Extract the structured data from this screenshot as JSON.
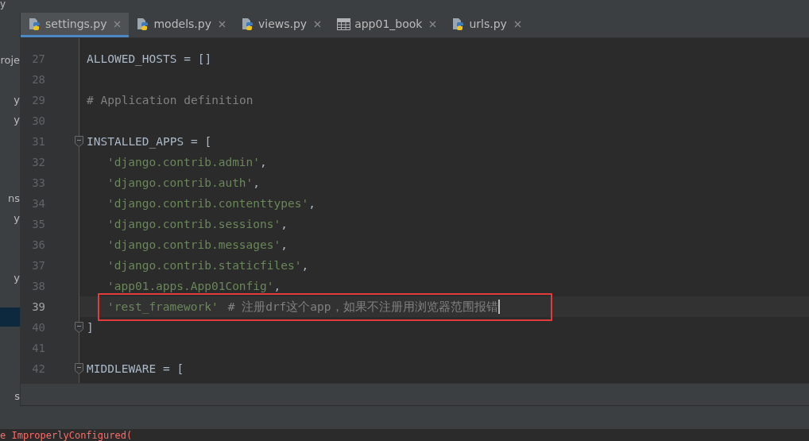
{
  "title_bar": {
    "text": "y"
  },
  "tabs": [
    {
      "label": "settings.py",
      "kind": "python",
      "selected": true
    },
    {
      "label": "models.py",
      "kind": "python",
      "selected": false
    },
    {
      "label": "views.py",
      "kind": "python",
      "selected": false
    },
    {
      "label": "app01_book",
      "kind": "table",
      "selected": false
    },
    {
      "label": "urls.py",
      "kind": "python",
      "selected": false
    }
  ],
  "project_panel": {
    "items": [
      {
        "text": "roje",
        "selected": false
      },
      {
        "selected": false
      },
      {
        "text": "y",
        "selected": false
      },
      {
        "text": "y",
        "selected": false
      },
      {
        "selected": false
      },
      {
        "selected": false
      },
      {
        "selected": false
      },
      {
        "text": "ns",
        "selected": false
      },
      {
        "text": "y",
        "selected": false
      },
      {
        "selected": false
      },
      {
        "selected": false
      },
      {
        "text": "y",
        "selected": false
      },
      {
        "selected": false
      },
      {
        "selected": true
      },
      {
        "selected": false
      },
      {
        "selected": false
      },
      {
        "selected": false
      },
      {
        "text": "s",
        "selected": false
      }
    ]
  },
  "editor": {
    "lines": [
      {
        "number": "27",
        "current": false,
        "fold": false,
        "indent": false,
        "annotated": false,
        "segments": [
          {
            "kind": "code",
            "text": "ALLOWED_HOSTS = []"
          }
        ]
      },
      {
        "number": "28",
        "current": false,
        "fold": false,
        "annotated": false
      },
      {
        "number": "29",
        "current": false,
        "fold": false,
        "indent": false,
        "annotated": false,
        "segments": [
          {
            "kind": "comment",
            "text": "# Application definition"
          }
        ]
      },
      {
        "number": "30",
        "current": false,
        "fold": false,
        "annotated": false
      },
      {
        "number": "31",
        "current": false,
        "fold": true,
        "indent": false,
        "annotated": false,
        "segments": [
          {
            "kind": "code",
            "text": "INSTALLED_APPS = ["
          }
        ]
      },
      {
        "number": "32",
        "current": false,
        "fold": false,
        "indent": true,
        "annotated": false,
        "segments": [
          {
            "kind": "string",
            "text": "'django.contrib.admin'"
          },
          {
            "kind": "code",
            "text": ","
          }
        ]
      },
      {
        "number": "33",
        "current": false,
        "fold": false,
        "indent": true,
        "annotated": false,
        "segments": [
          {
            "kind": "string",
            "text": "'django.contrib.auth'"
          },
          {
            "kind": "code",
            "text": ","
          }
        ]
      },
      {
        "number": "34",
        "current": false,
        "fold": false,
        "indent": true,
        "annotated": false,
        "segments": [
          {
            "kind": "string",
            "text": "'django.contrib.contenttypes'"
          },
          {
            "kind": "code",
            "text": ","
          }
        ]
      },
      {
        "number": "35",
        "current": false,
        "fold": false,
        "indent": true,
        "annotated": false,
        "segments": [
          {
            "kind": "string",
            "text": "'django.contrib.sessions'"
          },
          {
            "kind": "code",
            "text": ","
          }
        ]
      },
      {
        "number": "36",
        "current": false,
        "fold": false,
        "indent": true,
        "annotated": false,
        "segments": [
          {
            "kind": "string",
            "text": "'django.contrib.messages'"
          },
          {
            "kind": "code",
            "text": ","
          }
        ]
      },
      {
        "number": "37",
        "current": false,
        "fold": false,
        "indent": true,
        "annotated": false,
        "segments": [
          {
            "kind": "string",
            "text": "'django.contrib.staticfiles'"
          },
          {
            "kind": "code",
            "text": ","
          }
        ]
      },
      {
        "number": "38",
        "current": false,
        "fold": false,
        "indent": true,
        "annotated": false,
        "segments": [
          {
            "kind": "string",
            "text": "'app01.apps.App01Config'"
          },
          {
            "kind": "code",
            "text": ","
          }
        ]
      },
      {
        "number": "39",
        "current": true,
        "fold": false,
        "indent": true,
        "annotated": true,
        "segments": [
          {
            "kind": "string",
            "text": "'rest_framework'"
          },
          {
            "kind": "comment",
            "text": "# 注册drf这个app，如果不注册用浏览器范围报错"
          }
        ]
      },
      {
        "number": "40",
        "current": false,
        "fold": true,
        "indent": false,
        "annotated": false,
        "segments": [
          {
            "kind": "code",
            "text": "]"
          }
        ]
      },
      {
        "number": "41",
        "current": false,
        "fold": false,
        "annotated": false
      },
      {
        "number": "42",
        "current": false,
        "fold": true,
        "indent": false,
        "annotated": false,
        "segments": [
          {
            "kind": "code",
            "text": "MIDDLEWARE = ["
          }
        ]
      }
    ]
  },
  "console": {
    "text": "e ImproperlyConfigured("
  }
}
